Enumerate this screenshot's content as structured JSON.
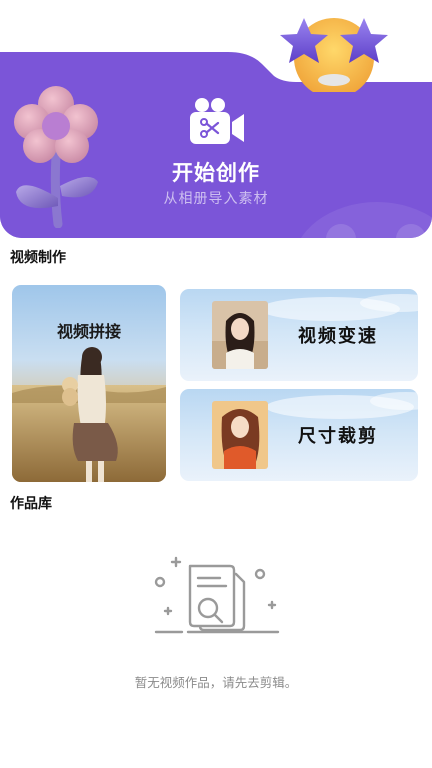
{
  "hero": {
    "title": "开始创作",
    "subtitle": "从相册导入素材",
    "accent": "#7b55d8"
  },
  "sections": {
    "video_make": "视频制作",
    "works": "作品库"
  },
  "cards": {
    "splice": "视频拼接",
    "speed": "视频变速",
    "crop": "尺寸裁剪"
  },
  "empty": {
    "message": "暂无视频作品，请先去剪辑。",
    "icon": "empty-document-search-icon"
  },
  "icons": {
    "camera": "video-camera-scissors-icon",
    "flower": "flower-decoration-icon",
    "stars": "star-eyes-emoji-icon"
  }
}
